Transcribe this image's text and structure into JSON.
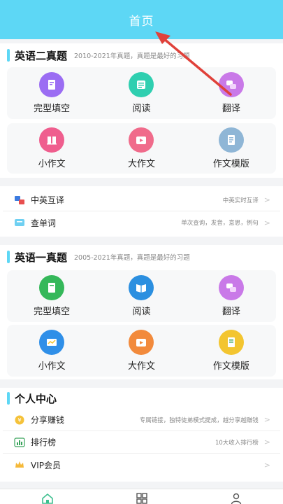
{
  "header": {
    "title": "首页"
  },
  "section1": {
    "title": "英语二真题",
    "subtitle": "2010-2021年真题，真题是最好的习题",
    "row1": [
      {
        "label": "完型填空",
        "icon": "cloze-icon",
        "color": "#9b6df3"
      },
      {
        "label": "阅读",
        "icon": "reading-icon",
        "color": "#2fcfb0"
      },
      {
        "label": "翻译",
        "icon": "translate-icon",
        "color": "#c979e8"
      }
    ],
    "row2": [
      {
        "label": "小作文",
        "icon": "short-essay-icon",
        "color": "#ef5e8e"
      },
      {
        "label": "大作文",
        "icon": "long-essay-icon",
        "color": "#f06b8b"
      },
      {
        "label": "作文模版",
        "icon": "template-icon",
        "color": "#8fb6d6"
      }
    ]
  },
  "tools": [
    {
      "label": "中英互译",
      "desc": "中英实时互译",
      "icon": "translate-tool-icon"
    },
    {
      "label": "查单词",
      "desc": "单次查询，发音，意思，例句",
      "icon": "dictionary-icon"
    }
  ],
  "section2": {
    "title": "英语一真题",
    "subtitle": "2005-2021年真题，真题是最好的习题",
    "row1": [
      {
        "label": "完型填空",
        "icon": "cloze-icon",
        "color": "#35b85a"
      },
      {
        "label": "阅读",
        "icon": "reading-icon",
        "color": "#2b8fe0"
      },
      {
        "label": "翻译",
        "icon": "translate-icon",
        "color": "#c979e8"
      }
    ],
    "row2": [
      {
        "label": "小作文",
        "icon": "short-essay-icon",
        "color": "#2f8fe8"
      },
      {
        "label": "大作文",
        "icon": "long-essay-icon",
        "color": "#f28a3c"
      },
      {
        "label": "作文模版",
        "icon": "template-icon",
        "color": "#f3c530"
      }
    ]
  },
  "personal": {
    "title": "个人中心",
    "items": [
      {
        "label": "分享赚钱",
        "desc": "专属链接，独特徒弟模式提成，越分享越赚钱",
        "icon": "coin-icon"
      },
      {
        "label": "排行榜",
        "desc": "10大收入排行榜",
        "icon": "ranking-icon"
      },
      {
        "label": "VIP会员",
        "desc": "",
        "icon": "crown-icon"
      }
    ]
  },
  "tabbar": [
    {
      "name": "home-tab",
      "icon": "home-icon"
    },
    {
      "name": "category-tab",
      "icon": "grid-icon"
    },
    {
      "name": "profile-tab",
      "icon": "user-icon"
    }
  ],
  "colors": {
    "accent": "#5dd7f5",
    "arrow": "#e0413a"
  }
}
